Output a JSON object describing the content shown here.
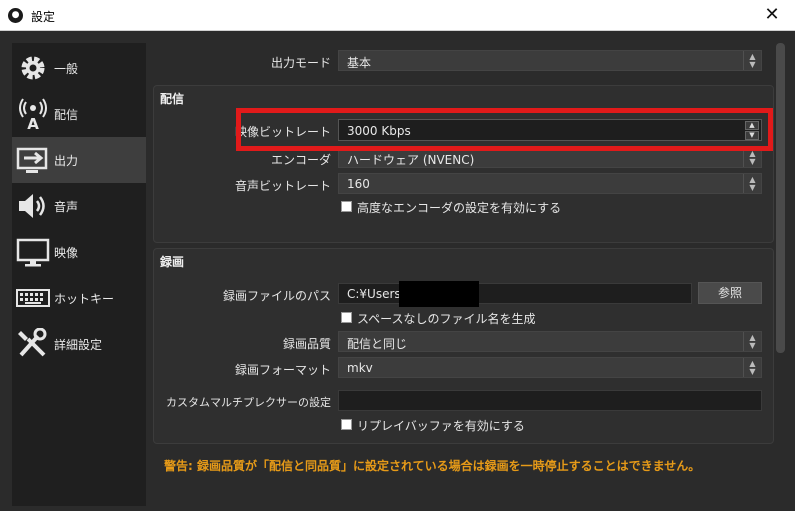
{
  "window": {
    "title": "設定",
    "close_glyph": "✕"
  },
  "sidebar": {
    "items": [
      {
        "label": "一般",
        "icon": "gear-icon"
      },
      {
        "label": "配信",
        "icon": "stream-antenna-icon"
      },
      {
        "label": "出力",
        "icon": "output-monitor-icon",
        "active": true
      },
      {
        "label": "音声",
        "icon": "speaker-icon"
      },
      {
        "label": "映像",
        "icon": "monitor-icon"
      },
      {
        "label": "ホットキー",
        "icon": "keyboard-icon"
      },
      {
        "label": "詳細設定",
        "icon": "wrench-screwdriver-icon"
      }
    ]
  },
  "output_mode": {
    "label": "出力モード",
    "value": "基本"
  },
  "streaming": {
    "title": "配信",
    "video_bitrate": {
      "label": "映像ビットレート",
      "value": "3000 Kbps"
    },
    "encoder": {
      "label": "エンコーダ",
      "value": "ハードウェア (NVENC)"
    },
    "audio_bitrate": {
      "label": "音声ビットレート",
      "value": "160"
    },
    "advanced_checkbox": "高度なエンコーダの設定を有効にする"
  },
  "recording": {
    "title": "録画",
    "path": {
      "label": "録画ファイルのパス",
      "value": "C:¥Users¥",
      "browse": "参照"
    },
    "no_space_checkbox": "スペースなしのファイル名を生成",
    "quality": {
      "label": "録画品質",
      "value": "配信と同じ"
    },
    "format": {
      "label": "録画フォーマット",
      "value": "mkv"
    },
    "muxer": {
      "label": "カスタムマルチプレクサーの設定",
      "value": ""
    },
    "replay_buffer_checkbox": "リプレイバッファを有効にする"
  },
  "warning": "警告: 録画品質が「配信と同品質」に設定されている場合は録画を一時停止することはできません。",
  "colors": {
    "highlight": "#e11a1a",
    "warning": "#e69a18",
    "background": "#2b2b2b"
  }
}
